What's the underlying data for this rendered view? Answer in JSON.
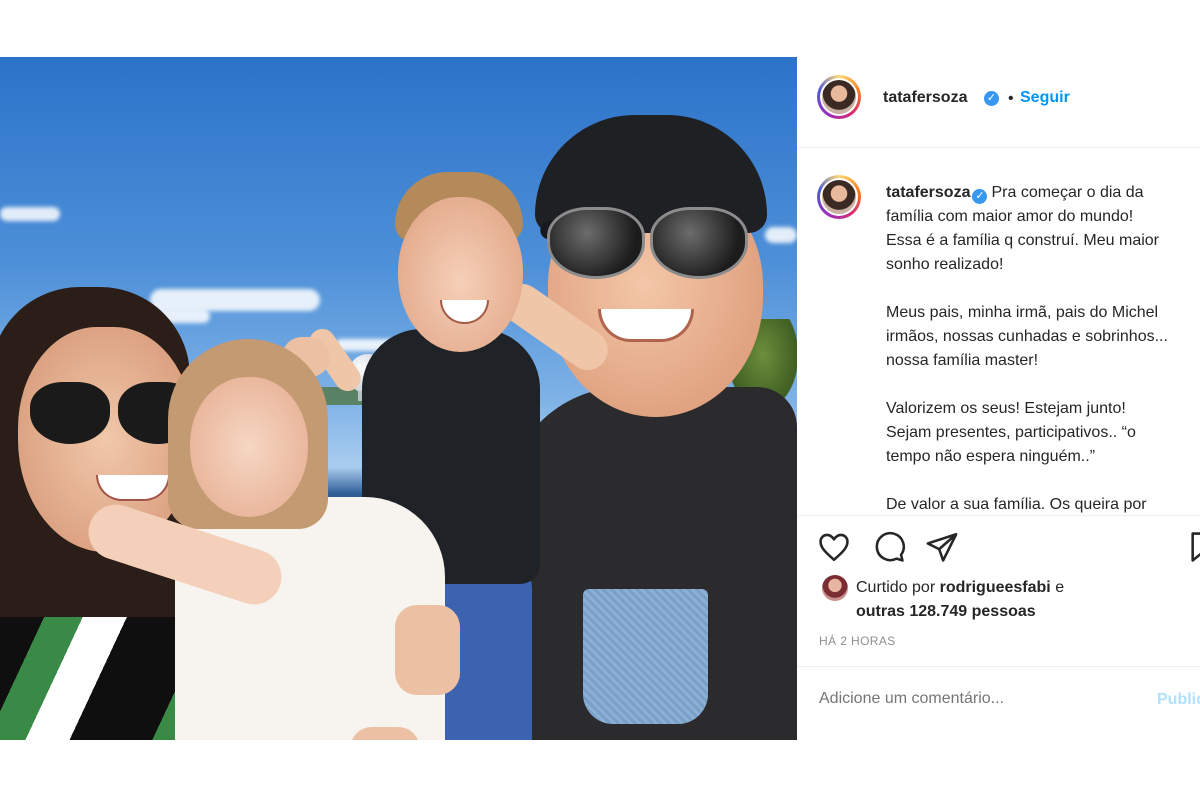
{
  "post": {
    "username": "tatafersoza",
    "verified_symbol": "✓",
    "separator": "•",
    "follow_label": "Seguir",
    "caption_paragraphs": [
      [
        "Pra começar o dia da",
        "família com maior amor do mundo!",
        "Essa é a família q construí. Meu maior",
        "sonho realizado!"
      ],
      [
        "Meus pais, minha irmã, pais do Michel",
        "irmãos, nossas cunhadas e sobrinhos...",
        "nossa família master!"
      ],
      [
        "Valorizem os seus! Estejam junto!",
        "Sejam presentes, participativos.. “o",
        "tempo não espera ninguém..”"
      ],
      [
        "De valor a sua família. Os queira por"
      ]
    ],
    "liked_by_prefix": "Curtido por",
    "liked_by_user": "rodrigueesfabi",
    "liked_by_and": "e",
    "likes_others": "outras 128.749 pessoas",
    "timestamp": "HÁ 2 HORAS",
    "comment_placeholder": "Adicione um comentário...",
    "publish_label": "Publicar"
  },
  "icons": [
    "heart-icon",
    "comment-icon",
    "share-icon",
    "save-icon"
  ],
  "colors": {
    "link": "#0095f6",
    "verified": "#3897f0",
    "muted": "#8e8e8e",
    "publish_disabled": "#b2dffc"
  }
}
